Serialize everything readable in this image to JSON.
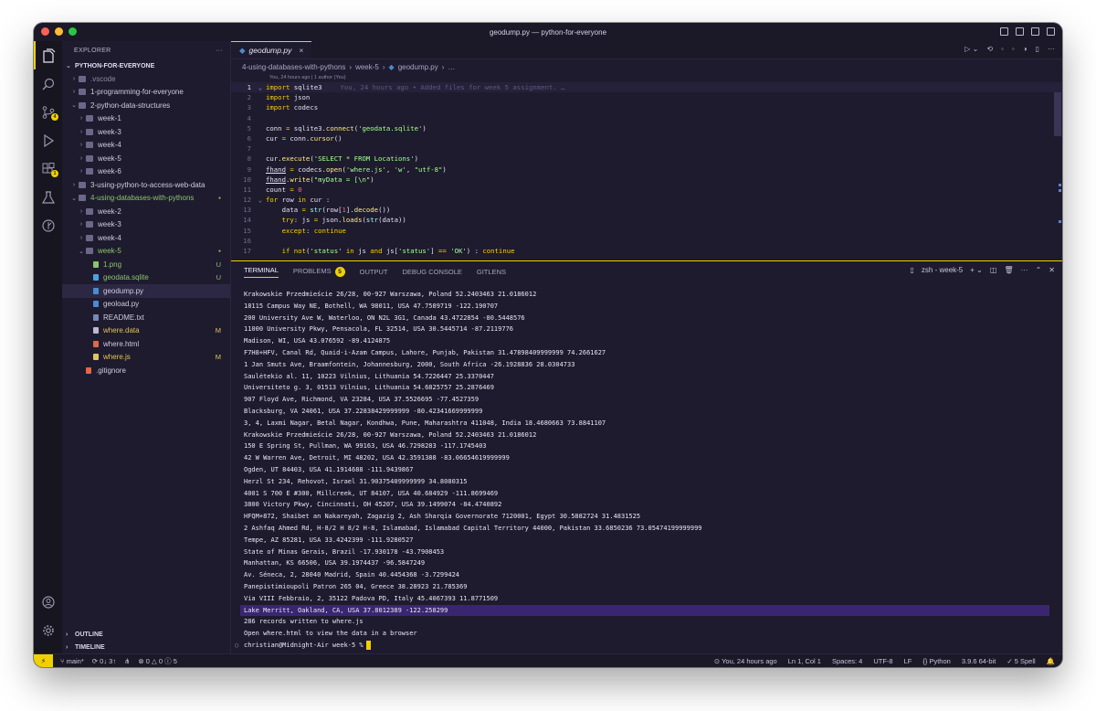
{
  "window": {
    "title": "geodump.py — python-for-everyone"
  },
  "explorer": {
    "header": "EXPLORER",
    "root": "PYTHON-FOR-EVERYONE",
    "items": [
      {
        "label": ".vscode",
        "kind": "folder",
        "depth": 1,
        "chev": "›",
        "color": "dim"
      },
      {
        "label": "1-programming-for-everyone",
        "kind": "folder",
        "depth": 1,
        "chev": "›"
      },
      {
        "label": "2-python-data-structures",
        "kind": "folder",
        "depth": 1,
        "chev": "⌄"
      },
      {
        "label": "week-1",
        "kind": "folder",
        "depth": 2,
        "chev": "›"
      },
      {
        "label": "week-3",
        "kind": "folder",
        "depth": 2,
        "chev": "›"
      },
      {
        "label": "week-4",
        "kind": "folder",
        "depth": 2,
        "chev": "›"
      },
      {
        "label": "week-5",
        "kind": "folder",
        "depth": 2,
        "chev": "›"
      },
      {
        "label": "week-6",
        "kind": "folder",
        "depth": 2,
        "chev": "›"
      },
      {
        "label": "3-using-python-to-access-web-data",
        "kind": "folder",
        "depth": 1,
        "chev": "›"
      },
      {
        "label": "4-using-databases-with-pythons",
        "kind": "folder",
        "depth": 1,
        "chev": "⌄",
        "color": "green",
        "badge": "●"
      },
      {
        "label": "week-2",
        "kind": "folder",
        "depth": 2,
        "chev": "›"
      },
      {
        "label": "week-3",
        "kind": "folder",
        "depth": 2,
        "chev": "›"
      },
      {
        "label": "week-4",
        "kind": "folder",
        "depth": 2,
        "chev": "›"
      },
      {
        "label": "week-5",
        "kind": "folder",
        "depth": 2,
        "chev": "⌄",
        "color": "green",
        "badge": "●"
      },
      {
        "label": "1.png",
        "kind": "file",
        "depth": 3,
        "color": "green",
        "badge": "U",
        "icon": "#8ac46c"
      },
      {
        "label": "geodata.sqlite",
        "kind": "file",
        "depth": 3,
        "color": "green",
        "badge": "U",
        "icon": "#4aa3df"
      },
      {
        "label": "geodump.py",
        "kind": "file",
        "depth": 3,
        "selected": true,
        "icon": "#4a8bd0"
      },
      {
        "label": "geoload.py",
        "kind": "file",
        "depth": 3,
        "icon": "#4a8bd0"
      },
      {
        "label": "README.txt",
        "kind": "file",
        "depth": 3,
        "icon": "#7b86b8"
      },
      {
        "label": "where.data",
        "kind": "file",
        "depth": 3,
        "color": "yellow",
        "badge": "M",
        "icon": "#bdb8d2"
      },
      {
        "label": "where.html",
        "kind": "file",
        "depth": 3,
        "icon": "#e2664a"
      },
      {
        "label": "where.js",
        "kind": "file",
        "depth": 3,
        "color": "yellow",
        "badge": "M",
        "icon": "#e3c25a"
      },
      {
        "label": ".gitignore",
        "kind": "file",
        "depth": 2,
        "icon": "#e2664a"
      }
    ],
    "outline": "OUTLINE",
    "timeline": "TIMELINE"
  },
  "activity": {
    "scm_badge": "4",
    "ext_badge": "1"
  },
  "editor": {
    "tab": "geodump.py",
    "breadcrumb": [
      "4-using-databases-with-pythons",
      "week-5",
      "geodump.py",
      "…"
    ],
    "blame_header": "You, 24 hours ago | 1 author (You)",
    "inline_blame": "You, 24 hours ago • Added files for week 5 assignment. …",
    "line_numbers": [
      "1",
      "2",
      "3",
      "4",
      "5",
      "6",
      "7",
      "8",
      "9",
      "10",
      "11",
      "12",
      "13",
      "14",
      "15",
      "16",
      "17"
    ]
  },
  "panel": {
    "tabs": [
      "TERMINAL",
      "PROBLEMS",
      "OUTPUT",
      "DEBUG CONSOLE",
      "GITLENS"
    ],
    "problems_count": "5",
    "shell": "zsh - week-5",
    "lines": [
      "Krakowskie Przedmieście 26/28, 00-927 Warszawa, Poland 52.2403463 21.0186012",
      "18115 Campus Way NE, Bothell, WA 98011, USA 47.7589719 -122.190707",
      "200 University Ave W, Waterloo, ON N2L 3G1, Canada 43.4722854 -80.5448576",
      "11000 University Pkwy, Pensacola, FL 32514, USA 30.5445714 -87.2119776",
      "Madison, WI, USA 43.076592 -89.4124875",
      "F7H8+HFV, Canal Rd, Quaid-i-Azam Campus, Lahore, Punjab, Pakistan 31.47898409999999 74.2661627",
      "1 Jan Smuts Ave, Braamfontein, Johannesburg, 2000, South Africa -26.1928836 28.0304733",
      "Saulėtekio al. 11, 10223 Vilnius, Lithuania 54.7226447 25.3370447",
      "Universiteto g. 3, 01513 Vilnius, Lithuania 54.6825757 25.2876469",
      "907 Floyd Ave, Richmond, VA 23284, USA 37.5526695 -77.4527359",
      "Blacksburg, VA 24061, USA 37.22838429999999 -80.42341669999999",
      "3, 4, Laxmi Nagar, Betal Nagar, Kondhwa, Pune, Maharashtra 411048, India 18.4680663 73.8841107",
      "Krakowskie Przedmieście 26/28, 00-927 Warszawa, Poland 52.2403463 21.0186012",
      "150 E Spring St, Pullman, WA 99163, USA 46.7298283 -117.1745403",
      "42 W Warren Ave, Detroit, MI 48202, USA 42.3591388 -83.06654619999999",
      "Ogden, UT 84403, USA 41.1914688 -111.9439867",
      "Herzl St 234, Rehovot, Israel 31.90375409999999 34.8080315",
      "4001 S 700 E #300, Millcreek, UT 84107, USA 40.684929 -111.8699469",
      "3800 Victory Pkwy, Cincinnati, OH 45207, USA 39.1499074 -84.4740892",
      "HFQM+872, Shaibet an Nakareyah, Zagazig 2, Ash Sharqia Governorate 7120001, Egypt 30.5882724 31.4831525",
      "2 Ashfaq Ahmed Rd, H-8/2 H 8/2 H-8, Islamabad, Islamabad Capital Territory 44000, Pakistan 33.6850236 73.05474199999999",
      "Tempe, AZ 85281, USA 33.4242399 -111.9280527",
      "State of Minas Gerais, Brazil -17.930178 -43.7908453",
      "Manhattan, KS 66506, USA 39.1974437 -96.5847249",
      "Av. Séneca, 2, 28040 Madrid, Spain 40.4454368 -3.7299424",
      "Panepistimioupoli Patron 265 04, Greece 38.28923 21.785369",
      "Via VIII Febbraio, 2, 35122 Padova PD, Italy 45.4067393 11.8771509",
      "Lake Merritt, Oakland, CA, USA 37.8012389 -122.258299",
      "286 records written to where.js",
      "Open where.html to view the data in a browser"
    ],
    "highlight_index": 27,
    "prompt": "christian@Midnight-Air week-5 %"
  },
  "statusbar": {
    "branch": "main*",
    "sync": "0↓ 3↑",
    "errors": "0",
    "warnings": "0",
    "info": "5",
    "blame": "You, 24 hours ago",
    "position": "Ln 1, Col 1",
    "spaces": "Spaces: 4",
    "encoding": "UTF-8",
    "eol": "LF",
    "language": "Python",
    "interpreter": "3.9.6 64-bit",
    "spell": "5 Spell"
  }
}
